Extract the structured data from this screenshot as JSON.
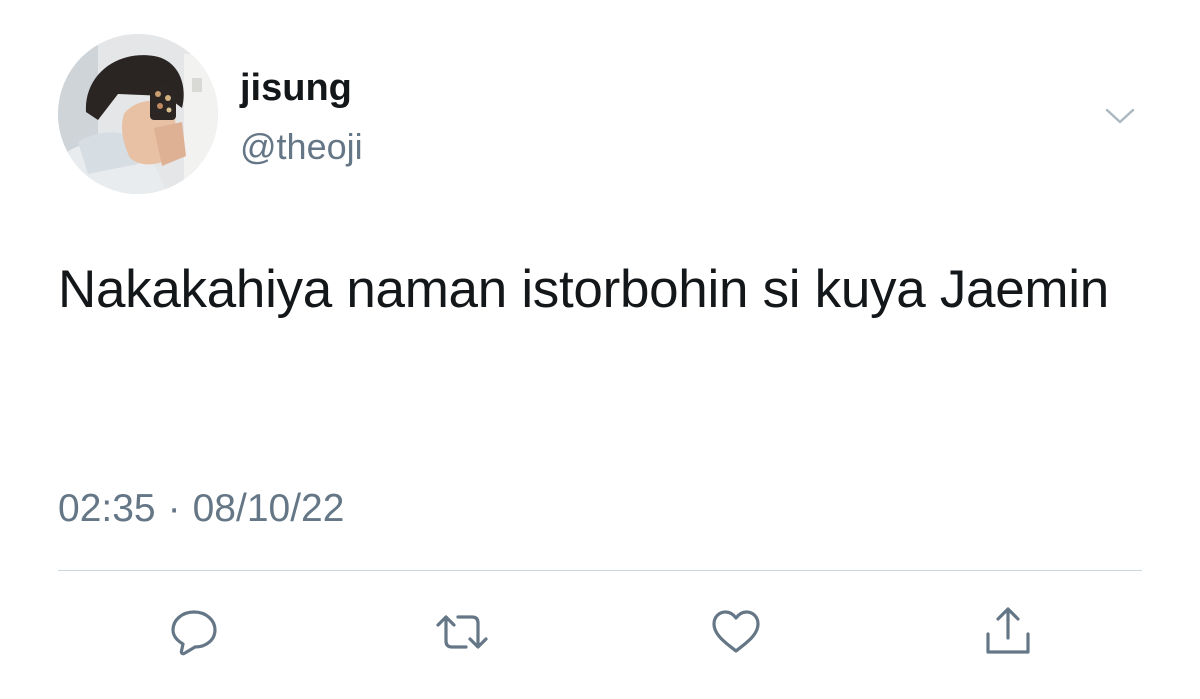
{
  "tweet": {
    "author": {
      "display_name": "jisung",
      "handle": "@theoji",
      "avatar_icon": "avatar-photo"
    },
    "text": "Nakakahiya naman istorbohin si kuya Jaemin",
    "time": "02:35",
    "separator": "·",
    "date": "08/10/22"
  },
  "actions": {
    "reply_icon": "reply-icon",
    "retweet_icon": "retweet-icon",
    "like_icon": "heart-icon",
    "share_icon": "share-icon",
    "more_icon": "chevron-down-icon"
  },
  "colors": {
    "text_primary": "#14171a",
    "text_secondary": "#657786",
    "icon_gray": "#657786",
    "divider": "#ccd6dd"
  }
}
